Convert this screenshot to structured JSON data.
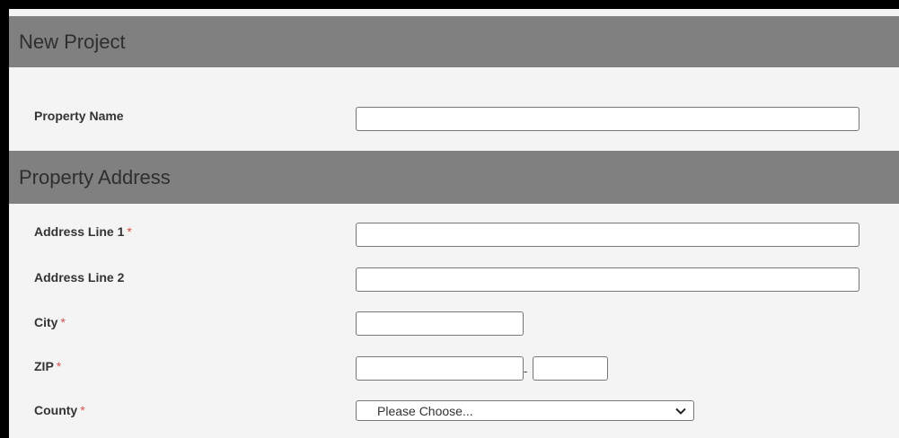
{
  "sections": {
    "new_project": "New Project",
    "property_address": "Property Address"
  },
  "fields": {
    "property_name": {
      "label": "Property Name",
      "value": ""
    },
    "address_line_1": {
      "label": "Address Line 1",
      "required": "*",
      "value": ""
    },
    "address_line_2": {
      "label": "Address Line 2",
      "value": ""
    },
    "city": {
      "label": "City",
      "required": "*",
      "value": ""
    },
    "zip": {
      "label": "ZIP",
      "required": "*",
      "value": "",
      "ext_value": "",
      "separator": "-"
    },
    "county": {
      "label": "County",
      "required": "*",
      "selected": "Please Choose..."
    }
  },
  "icons": {
    "county_dropdown": "chevron-down-icon"
  },
  "colors": {
    "header_bg": "#808080",
    "required_star": "#d9534f",
    "form_bg": "#f4f4f4"
  }
}
